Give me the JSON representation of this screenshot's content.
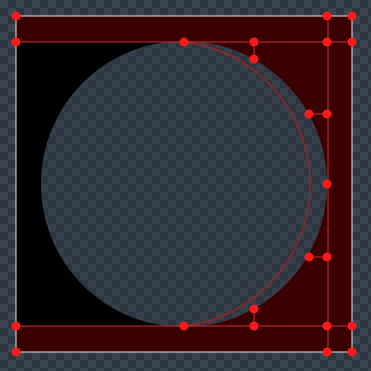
{
  "canvas": {
    "background_checker_light": "#3b4551",
    "background_checker_dark": "#2c343d",
    "fill_black": "#000000",
    "shape_fill": "#2f3945",
    "region_fill": "#3a0000",
    "outline_red": "#cc2b2b",
    "handle_red": "#ff1a1a",
    "frame_white": "#e6e6e6"
  },
  "icons": {
    "handle": "circle-handle-icon"
  }
}
